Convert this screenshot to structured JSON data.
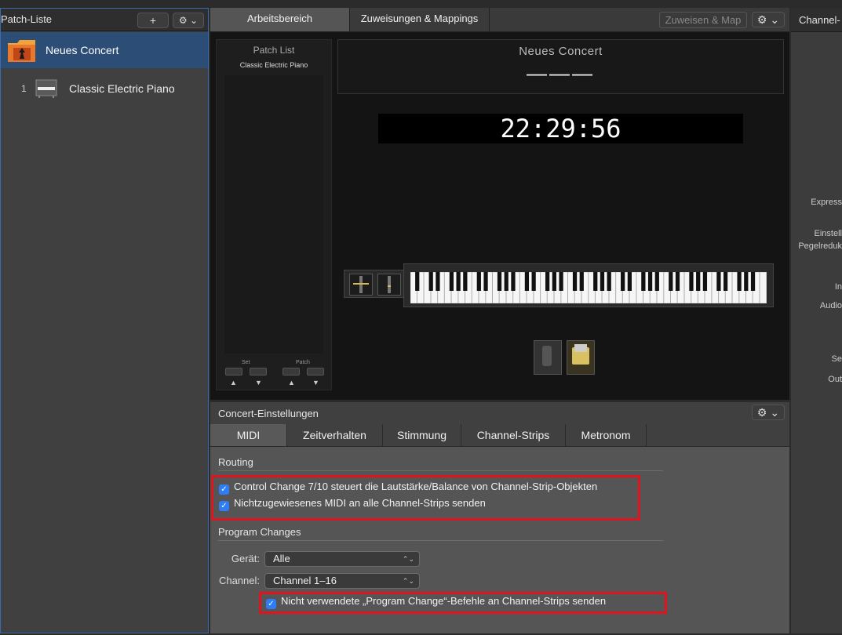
{
  "left_panel": {
    "title": "Patch-Liste",
    "add_icon": "+",
    "gear_icon": "⚙ ⌄",
    "concert_label": "Neues Concert",
    "patch_number": "1",
    "patch_label": "Classic Electric Piano"
  },
  "center": {
    "tabs": [
      "Arbeitsbereich",
      "Zuweisungen & Mappings"
    ],
    "assign_button": "Zuweisen & Map",
    "gear_icon": "⚙ ⌄",
    "patch_list_title": "Patch List",
    "patch_list_item": "Classic Electric Piano",
    "set_label": "Set",
    "patch_label": "Patch",
    "up_arrow": "▲",
    "down_arrow": "▼",
    "concert_name": "Neues Concert",
    "concert_dash": "———",
    "clock": "22:29:56"
  },
  "bottom": {
    "title": "Concert-Einstellungen",
    "gear_icon": "⚙ ⌄",
    "tabs": [
      "MIDI",
      "Zeitverhalten",
      "Stimmung",
      "Channel-Strips",
      "Metronom"
    ],
    "routing_title": "Routing",
    "routing_cc": "Control Change 7/10 steuert die Lautstärke/Balance von Channel-Strip-Objekten",
    "routing_midi": "Nichtzugewiesenes MIDI an alle Channel-Strips senden",
    "program_changes_title": "Program Changes",
    "device_label": "Gerät:",
    "device_value": "Alle",
    "channel_label": "Channel:",
    "channel_value": "Channel 1–16",
    "pc_checkbox": "Nicht verwendete „Program Change“-Befehle an Channel-Strips senden",
    "check_glyph": "✓",
    "select_arrow": "⌃⌄"
  },
  "right_panel": {
    "title": "Channel-",
    "labels": [
      "Express",
      "Einstell",
      "Pegelreduk",
      "In",
      "Audio",
      "Se",
      "Out"
    ]
  },
  "colors": {
    "accent_blue": "#2e7cf6",
    "selection_blue": "#2c4d76",
    "highlight_red": "#e0141e"
  }
}
